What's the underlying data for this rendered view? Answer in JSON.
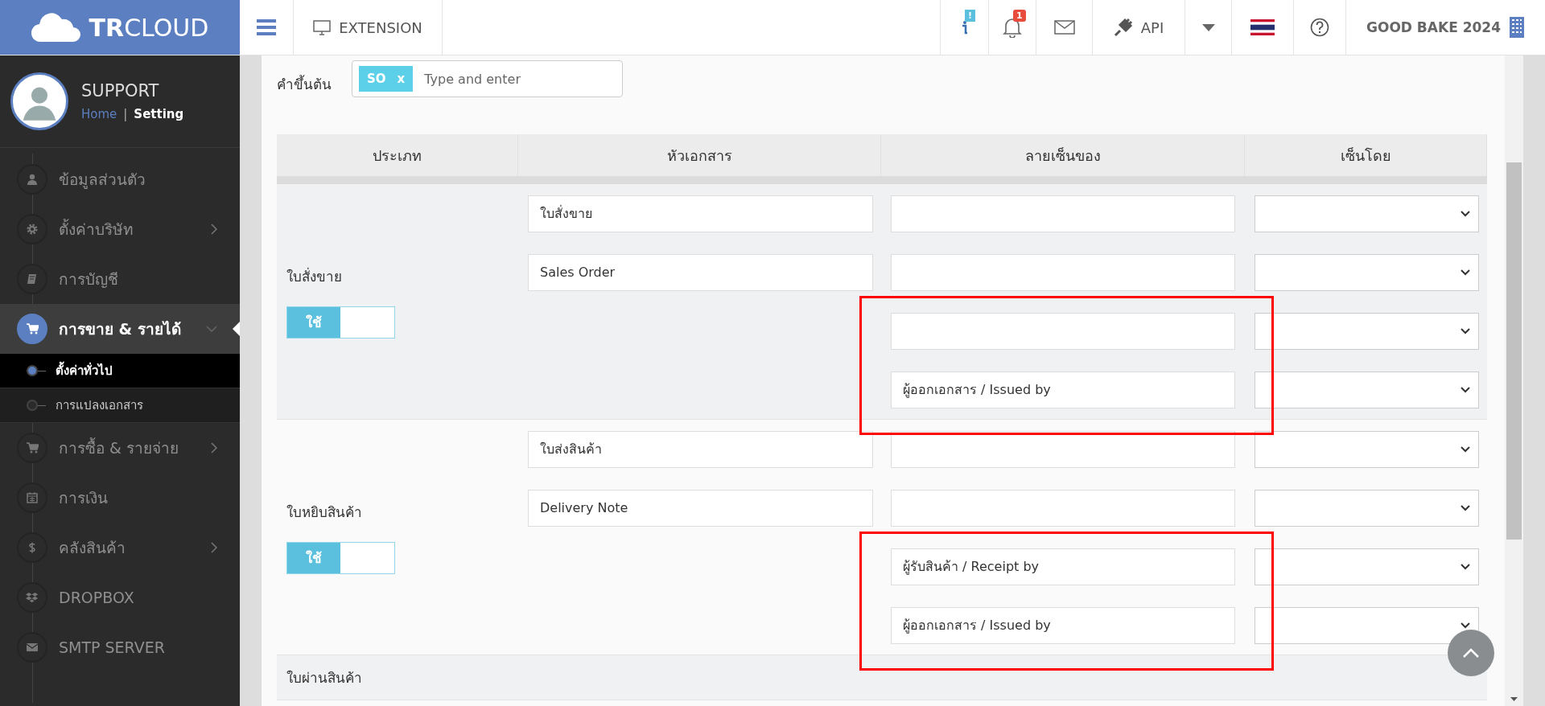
{
  "topbar": {
    "brand": "**TR**CLOUD",
    "menu_label": "EXTENSION",
    "info_badge": "!",
    "notification_count": "1",
    "api_label": "API",
    "company": "GOOD BAKE 2024"
  },
  "sidebar": {
    "user": "SUPPORT",
    "breadcrumb": [
      {
        "label": "Home",
        "selected": false
      },
      {
        "label": "Setting",
        "selected": true
      }
    ],
    "breadcrumb_separator": "|",
    "items": [
      {
        "label": "ข้อมูลส่วนตัว",
        "has_submenu": false,
        "expanded": false
      },
      {
        "label": "ตั้งค่าบริษัท",
        "has_submenu": true,
        "expanded": false
      },
      {
        "label": "การบัญชี",
        "has_submenu": false,
        "expanded": false
      },
      {
        "label": "การขาย & รายได้",
        "has_submenu": true,
        "expanded": true,
        "children": [
          {
            "label": "ตั้งค่าทั่วไป",
            "selected": true
          },
          {
            "label": "การแปลงเอกสาร",
            "selected": false
          }
        ]
      },
      {
        "label": "การซื้อ & รายจ่าย",
        "has_submenu": true,
        "expanded": false
      },
      {
        "label": "การเงิน",
        "has_submenu": false,
        "expanded": false
      },
      {
        "label": "คลังสินค้า",
        "has_submenu": true,
        "expanded": false
      },
      {
        "label": "DROPBOX",
        "has_submenu": false,
        "expanded": false
      },
      {
        "label": "SMTP SERVER",
        "has_submenu": false,
        "expanded": false
      }
    ]
  },
  "prefix": {
    "label": "คำขึ้นต้น",
    "tags": [
      {
        "label": "SO",
        "remove": "x"
      }
    ],
    "placeholder": "Type and enter"
  },
  "table": {
    "columns": [
      "ประเภท",
      "หัวเอกสาร",
      "ลายเซ็นของ",
      "เซ็นโดย"
    ],
    "groups": [
      {
        "type": "ใบสั่งขาย",
        "toggle": {
          "label": "ใช้",
          "on": true
        },
        "rows": [
          {
            "title": "ใบสั่งขาย",
            "highlighted": false
          },
          {
            "title": "Sales Order",
            "highlighted": false
          },
          {
            "highlighted": true
          },
          {
            "signature": "ผู้ออกเอกสาร / Issued by",
            "highlighted": true
          }
        ]
      },
      {
        "type": "ใบหยิบสินค้า",
        "toggle": {
          "label": "ใช้",
          "on": true
        },
        "rows": [
          {
            "title": "ใบส่งสินค้า",
            "highlighted": false
          },
          {
            "title": "Delivery Note",
            "highlighted": false
          },
          {
            "signature": "ผู้รับสินค้า / Receipt by",
            "highlighted": true
          },
          {
            "signature": "ผู้ออกเอกสาร / Issued by",
            "highlighted": true
          }
        ]
      },
      {
        "type": "ใบผ่านสินค้า"
      }
    ]
  }
}
